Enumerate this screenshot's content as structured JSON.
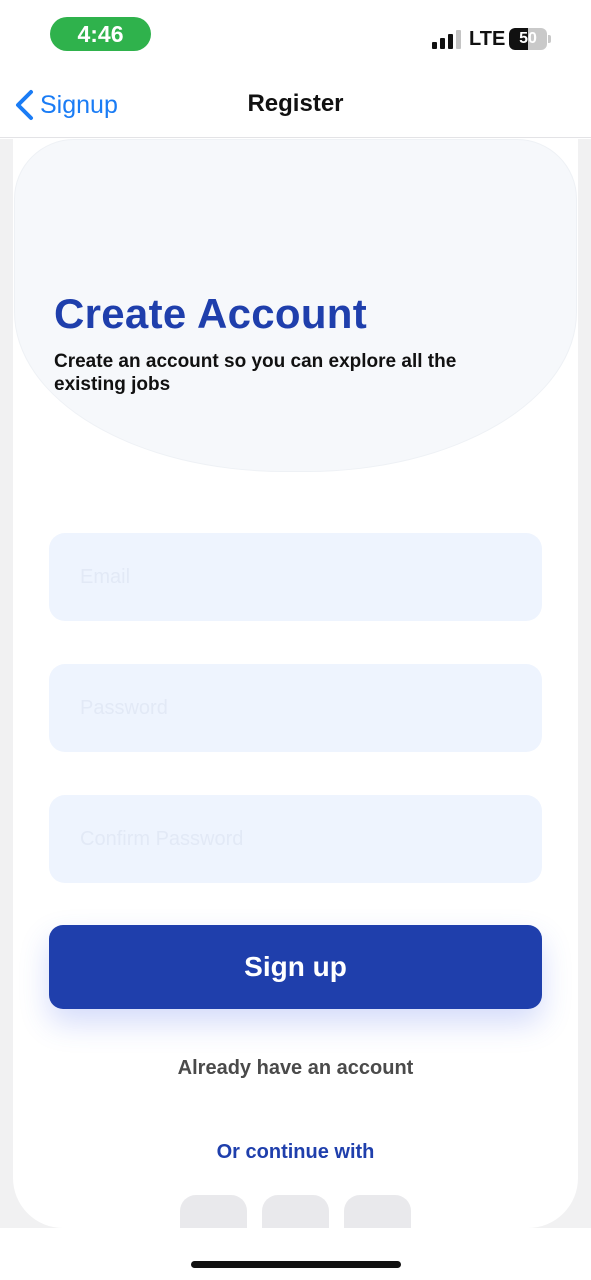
{
  "status_bar": {
    "time": "4:46",
    "network": "LTE",
    "battery_level": "50",
    "battery_fraction": 0.5,
    "signal_bars_active": 3,
    "colors": {
      "time_pill": "#2fb24c"
    }
  },
  "nav": {
    "back_label": "Signup",
    "title": "Register",
    "colors": {
      "back": "#1a7cf5"
    }
  },
  "hero": {
    "heading": "Create Account",
    "subheading": "Create an account so you can explore all the existing jobs"
  },
  "form": {
    "email": {
      "placeholder": "Email",
      "value": ""
    },
    "password": {
      "placeholder": "Password",
      "value": ""
    },
    "confirm_password": {
      "placeholder": "Confirm Password",
      "value": ""
    },
    "signup_label": "Sign up",
    "account_link": "Already have an account",
    "continue_text": "Or continue with"
  },
  "social": [
    "google-icon",
    "facebook-icon",
    "apple-icon"
  ],
  "colors": {
    "primary": "#1f3fac",
    "field_bg": "#eef4fe"
  }
}
